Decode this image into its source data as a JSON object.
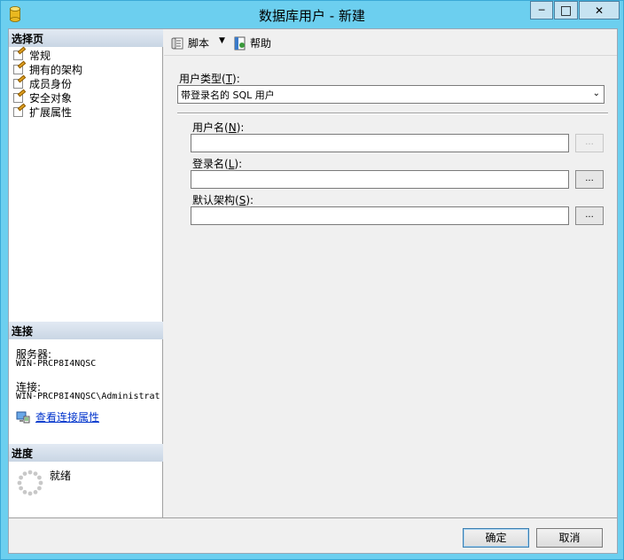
{
  "window": {
    "title": "数据库用户 - 新建",
    "minimize_glyph": "─",
    "maximize_glyph": "□",
    "close_glyph": "✕"
  },
  "left": {
    "select_page_header": "选择页",
    "pages": [
      {
        "label": "常规",
        "icon": "page-edit-icon"
      },
      {
        "label": "拥有的架构",
        "icon": "page-edit-icon"
      },
      {
        "label": "成员身份",
        "icon": "page-edit-icon"
      },
      {
        "label": "安全对象",
        "icon": "page-edit-icon"
      },
      {
        "label": "扩展属性",
        "icon": "page-edit-icon"
      }
    ],
    "connection_header": "连接",
    "server_label": "服务器:",
    "server_value": "WIN-PRCP8I4NQSC",
    "connection_label": "连接:",
    "connection_value": "WIN-PRCP8I4NQSC\\Administrat",
    "view_connection_props": "查看连接属性",
    "progress_header": "进度",
    "progress_status": "就绪"
  },
  "toolbar": {
    "script_label": "脚本",
    "dropdown_glyph": "▼",
    "help_label": "帮助"
  },
  "form": {
    "user_type_label": "用户类型",
    "user_type_key": "T",
    "user_type_value": "带登录名的 SQL 用户",
    "user_name_label": "用户名",
    "user_name_key": "N",
    "user_name_value": "",
    "login_name_label": "登录名",
    "login_name_key": "L",
    "login_name_value": "",
    "default_schema_label": "默认架构",
    "default_schema_key": "S",
    "default_schema_value": "",
    "browse_label": "..."
  },
  "buttons": {
    "ok": "确定",
    "cancel": "取消"
  },
  "colors": {
    "titlebar": "#6ccfef",
    "section_header": "#c9d6e4",
    "link": "#0033cc"
  }
}
